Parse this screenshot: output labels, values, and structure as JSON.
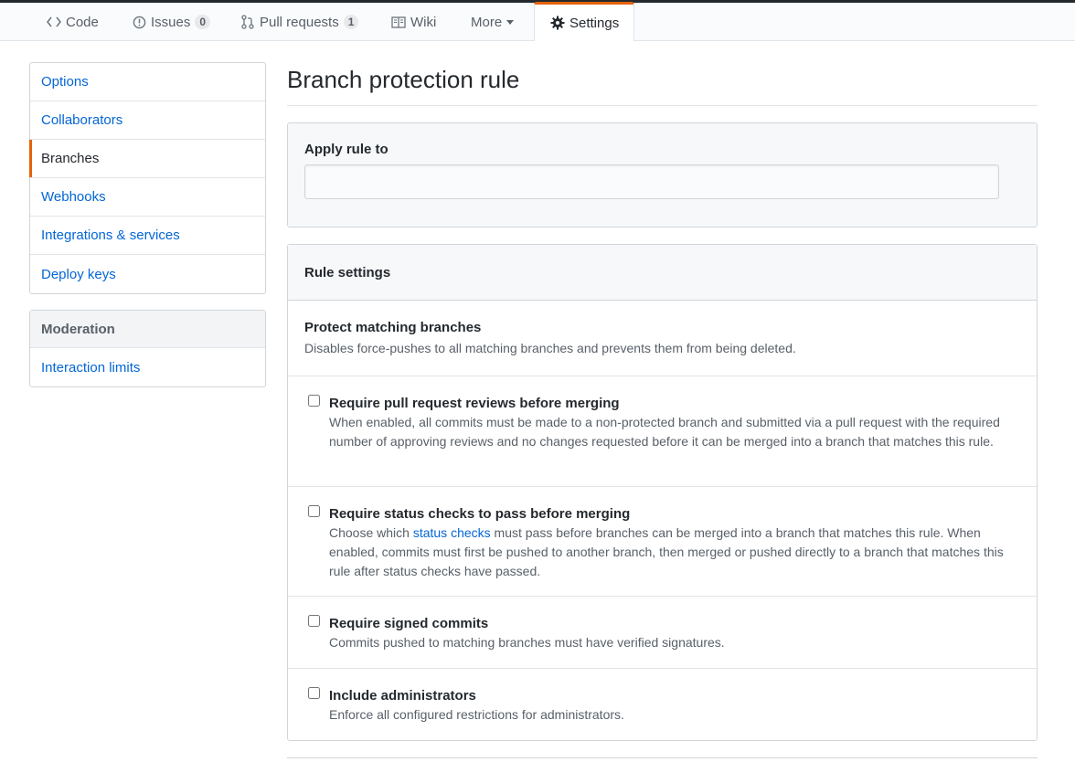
{
  "tabs": {
    "code": "Code",
    "issues": "Issues",
    "issues_count": "0",
    "pulls": "Pull requests",
    "pulls_count": "1",
    "wiki": "Wiki",
    "more": "More",
    "settings": "Settings"
  },
  "sidebar": {
    "items": [
      {
        "label": "Options"
      },
      {
        "label": "Collaborators"
      },
      {
        "label": "Branches"
      },
      {
        "label": "Webhooks"
      },
      {
        "label": "Integrations & services"
      },
      {
        "label": "Deploy keys"
      }
    ],
    "moderation_heading": "Moderation",
    "moderation_items": [
      {
        "label": "Interaction limits"
      }
    ]
  },
  "main": {
    "title": "Branch protection rule",
    "apply_label": "Apply rule to",
    "apply_value": "",
    "rule_settings": "Rule settings",
    "protect": {
      "title": "Protect matching branches",
      "desc": "Disables force-pushes to all matching branches and prevents them from being deleted."
    },
    "options": [
      {
        "title": "Require pull request reviews before merging",
        "desc": "When enabled, all commits must be made to a non-protected branch and submitted via a pull request with the required number of approving reviews and no changes requested before it can be merged into a branch that matches this rule."
      },
      {
        "title": "Require status checks to pass before merging",
        "desc_before": "Choose which ",
        "desc_link": "status checks",
        "desc_after": " must pass before branches can be merged into a branch that matches this rule. When enabled, commits must first be pushed to another branch, then merged or pushed directly to a branch that matches this rule after status checks have passed."
      },
      {
        "title": "Require signed commits",
        "desc": "Commits pushed to matching branches must have verified signatures."
      },
      {
        "title": "Include administrators",
        "desc": "Enforce all configured restrictions for administrators."
      }
    ]
  },
  "colors": {
    "accent": "#e36209",
    "link": "#0366d6",
    "text": "#24292e",
    "muted": "#586069"
  },
  "icons": {
    "code": "code-icon",
    "issues": "issue-opened-icon",
    "pulls": "git-pull-request-icon",
    "wiki": "book-icon",
    "settings": "gear-icon"
  }
}
